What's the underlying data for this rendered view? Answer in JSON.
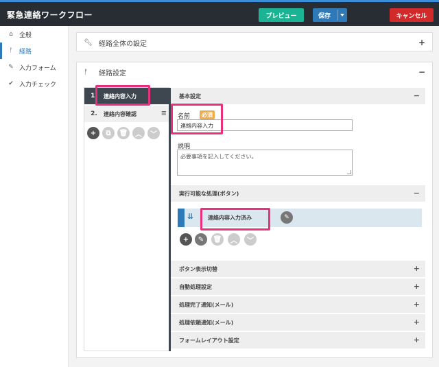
{
  "header": {
    "title": "緊急連絡ワークフロー",
    "preview_label": "プレビュー",
    "save_label": "保存",
    "cancel_label": "キャンセル"
  },
  "sidebar": {
    "items": [
      {
        "label": "全般",
        "icon": "home-icon"
      },
      {
        "label": "経路",
        "icon": "route-icon",
        "active": true
      },
      {
        "label": "入力フォーム",
        "icon": "pencil-icon"
      },
      {
        "label": "入力チェック",
        "icon": "check-icon"
      }
    ]
  },
  "main": {
    "overall_settings": {
      "title": "経路全体の設定",
      "toggle": "+"
    },
    "route_settings": {
      "title": "経路設定",
      "toggle": "−"
    },
    "routes": [
      {
        "num": "1.",
        "label": "連絡内容入力"
      },
      {
        "num": "2.",
        "label": "連絡内容確認",
        "menu": "≡"
      }
    ],
    "detail": {
      "basic": {
        "title": "基本設定",
        "toggle": "−"
      },
      "name_label": "名前",
      "required_badge": "必須",
      "name_value": "連絡内容入力",
      "desc_label": "説明",
      "desc_placeholder": "必要事項を記入してください。",
      "actions": {
        "title": "実行可能な処理(ボタン)",
        "toggle": "−"
      },
      "action_item": "連絡内容入力済み",
      "sections": [
        {
          "title": "ボタン表示切替",
          "toggle": "+"
        },
        {
          "title": "自動処理設定",
          "toggle": "+"
        },
        {
          "title": "処理完了通知(メール)",
          "toggle": "+"
        },
        {
          "title": "処理依頼通知(メール)",
          "toggle": "+"
        },
        {
          "title": "フォームレイアウト設定",
          "toggle": "+"
        }
      ]
    }
  },
  "colors": {
    "header_bg": "#272d33",
    "accent": "#2e79b8",
    "preview": "#1ab394",
    "cancel": "#d2292a",
    "highlight": "#e8307e",
    "badge": "#f0ad4e"
  }
}
